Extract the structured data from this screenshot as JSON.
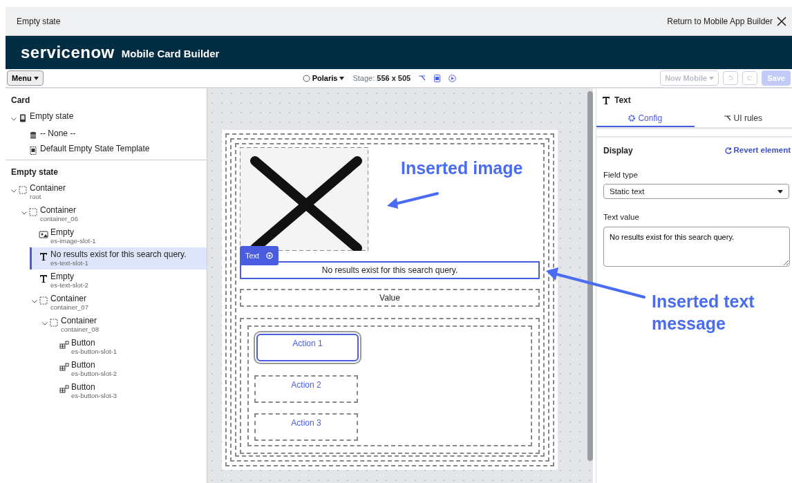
{
  "window": {
    "title": "Empty state",
    "return_link": "Return to Mobile App Builder"
  },
  "header": {
    "logo": "servicenow",
    "product": "Mobile Card Builder"
  },
  "toolbar": {
    "menu": "Menu",
    "theme": "Polaris",
    "stage_label": "Stage:",
    "stage_size": "556 x 505",
    "app_menu": "Now Mobile",
    "save": "Save",
    "save_disabled": true
  },
  "left_panel": {
    "card_section": {
      "title": "Card",
      "tree": [
        {
          "kind": "card",
          "title": "Empty state",
          "expanded": true,
          "children": [
            {
              "kind": "table",
              "title": "-- None --"
            },
            {
              "kind": "template",
              "title": "Default Empty State Template"
            }
          ]
        }
      ]
    },
    "layout_section": {
      "title": "Empty state",
      "tree": [
        {
          "kind": "container",
          "title": "Container",
          "subtitle": "root",
          "selected": false,
          "expanded": true,
          "children": [
            {
              "kind": "container",
              "title": "Container",
              "subtitle": "container_06",
              "selected": false,
              "expanded": true,
              "children": [
                {
                  "kind": "image",
                  "title": "Empty",
                  "subtitle": "es-image-slot-1",
                  "selected": false
                },
                {
                  "kind": "text",
                  "title": "No results exist for this search query.",
                  "subtitle": "es-text-slot-1",
                  "selected": true
                },
                {
                  "kind": "text",
                  "title": "Empty",
                  "subtitle": "es-text-slot-2",
                  "selected": false
                },
                {
                  "kind": "container",
                  "title": "Container",
                  "subtitle": "container_07",
                  "selected": false,
                  "expanded": true,
                  "children": [
                    {
                      "kind": "container",
                      "title": "Container",
                      "subtitle": "container_08",
                      "selected": false,
                      "expanded": true,
                      "children": [
                        {
                          "kind": "button",
                          "title": "Button",
                          "subtitle": "es-button-slot-1",
                          "selected": false
                        },
                        {
                          "kind": "button",
                          "title": "Button",
                          "subtitle": "es-button-slot-2",
                          "selected": false
                        },
                        {
                          "kind": "button",
                          "title": "Button",
                          "subtitle": "es-button-slot-3",
                          "selected": false
                        }
                      ]
                    }
                  ]
                }
              ]
            }
          ]
        }
      ]
    }
  },
  "canvas": {
    "text_slot": {
      "text": "No results exist for this search query.",
      "tag": "Text",
      "selected": true
    },
    "value_slot": {
      "text": "Value",
      "selected": false
    },
    "buttons": [
      {
        "label": "Action 1",
        "selected": true
      },
      {
        "label": "Action 2",
        "selected": false
      },
      {
        "label": "Action 3",
        "selected": false
      }
    ]
  },
  "right_panel": {
    "title": "Text",
    "tabs": [
      {
        "label": "Config",
        "kind": "config",
        "selected": true
      },
      {
        "label": "UI rules",
        "kind": "rules",
        "selected": false
      }
    ],
    "section": "Display",
    "revert": "Revert element",
    "field_type": {
      "label": "Field type",
      "value": "Static text"
    },
    "text_value": {
      "label": "Text value",
      "value": "No results exist for this search query."
    }
  },
  "annotations": [
    {
      "text": "Inserted image"
    },
    {
      "text": "Inserted text message"
    }
  ]
}
